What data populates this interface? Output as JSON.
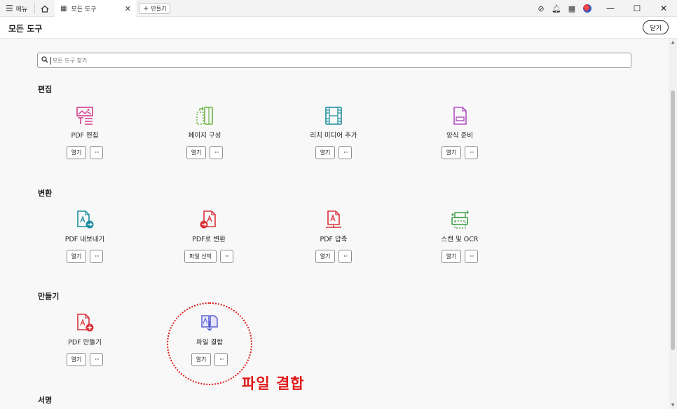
{
  "tabbar": {
    "menu_label": "메뉴",
    "tab_label": "모든 도구",
    "create_label": "만들기",
    "icons": [
      "hamburger-icon",
      "home-icon",
      "grid-icon",
      "close-icon",
      "plus-icon",
      "help-icon",
      "bell-icon",
      "apps-icon",
      "avatar",
      "minimize-icon",
      "maximize-icon",
      "close-window-icon"
    ]
  },
  "header": {
    "title": "모든 도구",
    "close_label": "닫기"
  },
  "search": {
    "placeholder": "모든 도구 찾기"
  },
  "sections": {
    "edit": {
      "title": "편집",
      "tools": [
        {
          "name": "PDF 편집",
          "open": "열기",
          "more": "···",
          "color": "#d43f8d"
        },
        {
          "name": "페이지 구성",
          "open": "열기",
          "more": "···",
          "color": "#6ab344"
        },
        {
          "name": "리치 미디어 추가",
          "open": "열기",
          "more": "···",
          "color": "#1b8ea0"
        },
        {
          "name": "양식 준비",
          "open": "열기",
          "more": "···",
          "color": "#b04fc1"
        }
      ]
    },
    "convert": {
      "title": "변환",
      "tools": [
        {
          "name": "PDF 내보내기",
          "open": "열기",
          "more": "···",
          "color": "#1b8ea0"
        },
        {
          "name": "PDF로 변환",
          "open": "파일 선택",
          "more": "···",
          "color": "#d9323a"
        },
        {
          "name": "PDF 압축",
          "open": "열기",
          "more": "···",
          "color": "#d9323a"
        },
        {
          "name": "스캔 및 OCR",
          "open": "열기",
          "more": "···",
          "color": "#3b9e46"
        }
      ]
    },
    "create": {
      "title": "만들기",
      "tools": [
        {
          "name": "PDF 만들기",
          "open": "열기",
          "more": "···",
          "color": "#d9323a"
        },
        {
          "name": "파일 결합",
          "open": "열기",
          "more": "···",
          "color": "#5a5fd1"
        }
      ]
    },
    "sign": {
      "title": "서명"
    }
  },
  "annotation": {
    "label": "파일 결합",
    "color": "#e01818"
  }
}
